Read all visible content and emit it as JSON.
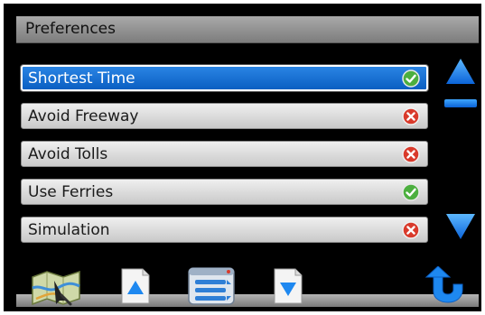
{
  "header": {
    "title": "Preferences"
  },
  "preferences": {
    "items": [
      {
        "label": "Shortest Time",
        "state": "enabled",
        "state_icon": "check-icon",
        "selected": true
      },
      {
        "label": "Avoid Freeway",
        "state": "disabled",
        "state_icon": "x-icon",
        "selected": false
      },
      {
        "label": "Avoid Tolls",
        "state": "disabled",
        "state_icon": "x-icon",
        "selected": false
      },
      {
        "label": "Use Ferries",
        "state": "enabled",
        "state_icon": "check-icon",
        "selected": false
      },
      {
        "label": "Simulation",
        "state": "disabled",
        "state_icon": "x-icon",
        "selected": false
      }
    ]
  },
  "scrollbar": {
    "up_icon": "triangle-up-icon",
    "down_icon": "triangle-down-icon",
    "position": 0
  },
  "toolbar": {
    "buttons": [
      {
        "name": "map-button",
        "icon": "map-icon"
      },
      {
        "name": "page-up-button",
        "icon": "page-up-icon"
      },
      {
        "name": "menu-button",
        "icon": "list-menu-icon"
      },
      {
        "name": "page-down-button",
        "icon": "page-down-icon"
      },
      {
        "name": "back-button",
        "icon": "back-arrow-icon"
      }
    ]
  },
  "colors": {
    "selection": "#1a73d9",
    "check": "#4caf3f",
    "cross": "#d93a2b",
    "scroll_arrow": "#1e88f0"
  }
}
